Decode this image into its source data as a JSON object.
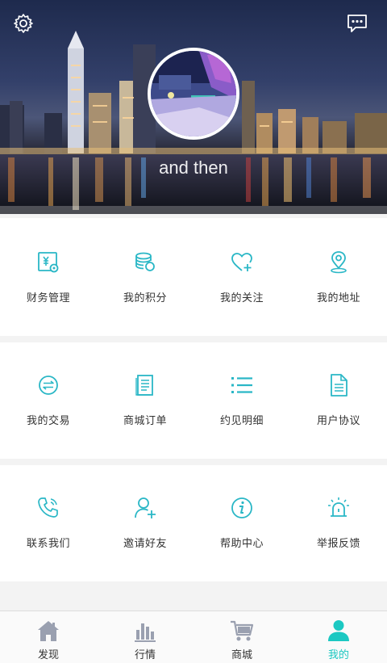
{
  "header": {
    "username": "and then",
    "settings_icon": "gear-icon",
    "message_icon": "chat-bubble-icon"
  },
  "sections": [
    {
      "items": [
        {
          "label": "财务管理",
          "icon": "finance-icon"
        },
        {
          "label": "我的积分",
          "icon": "coins-icon"
        },
        {
          "label": "我的关注",
          "icon": "heart-plus-icon"
        },
        {
          "label": "我的地址",
          "icon": "location-pin-icon"
        }
      ]
    },
    {
      "items": [
        {
          "label": "我的交易",
          "icon": "exchange-icon"
        },
        {
          "label": "商城订单",
          "icon": "order-list-icon"
        },
        {
          "label": "约见明细",
          "icon": "list-icon"
        },
        {
          "label": "用户协议",
          "icon": "document-icon"
        }
      ]
    },
    {
      "items": [
        {
          "label": "联系我们",
          "icon": "phone-icon"
        },
        {
          "label": "邀请好友",
          "icon": "add-user-icon"
        },
        {
          "label": "帮助中心",
          "icon": "info-icon"
        },
        {
          "label": "举报反馈",
          "icon": "alarm-icon"
        }
      ]
    }
  ],
  "tabbar": [
    {
      "label": "发现",
      "icon": "home-icon",
      "active": false
    },
    {
      "label": "行情",
      "icon": "bar-chart-icon",
      "active": false
    },
    {
      "label": "商城",
      "icon": "cart-icon",
      "active": false
    },
    {
      "label": "我的",
      "icon": "user-icon",
      "active": true
    }
  ],
  "colors": {
    "accent": "#1cc8c2",
    "icon_teal": "#2ab7c6",
    "inactive_tab": "#9aa0b0"
  }
}
